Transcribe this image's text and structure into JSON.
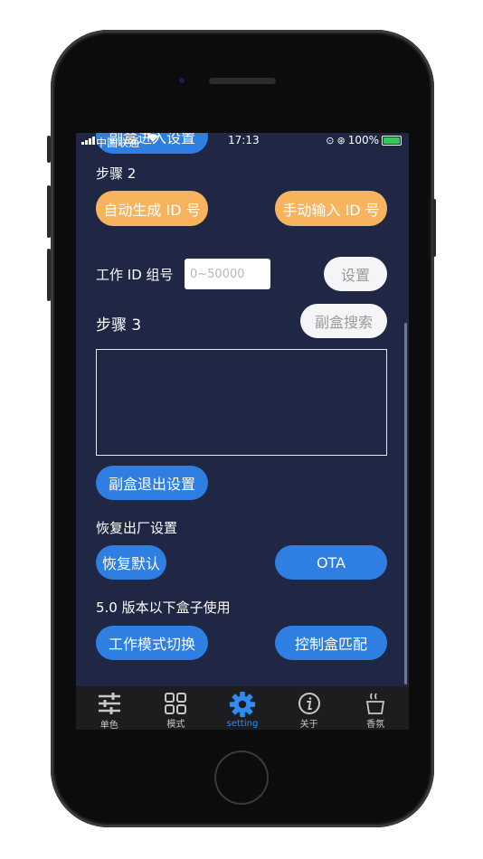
{
  "status": {
    "carrier": "中国联通",
    "time": "17:13",
    "battery": "100%"
  },
  "content": {
    "top_button": "副盒进入设置",
    "step2_label": "步骤 2",
    "auto_id_button": "自动生成 ID 号",
    "manual_id_button": "手动输入 ID 号",
    "work_id_label": "工作 ID 组号",
    "work_id_placeholder": "0~50000",
    "set_button": "设置",
    "step3_label": "步骤 3",
    "sub_search_button": "副盒搜索",
    "sub_exit_button": "副盒退出设置",
    "factory_label": "恢复出厂设置",
    "restore_button": "恢复默认",
    "ota_button": "OTA",
    "legacy_label": "5.0 版本以下盒子使用",
    "mode_switch_button": "工作模式切换",
    "control_match_button": "控制盒匹配"
  },
  "tabs": [
    {
      "label": "单色",
      "icon": "sliders-icon",
      "active": false
    },
    {
      "label": "模式",
      "icon": "grid-icon",
      "active": false
    },
    {
      "label": "setting",
      "icon": "gear-icon",
      "active": true
    },
    {
      "label": "关于",
      "icon": "info-icon",
      "active": false
    },
    {
      "label": "香氛",
      "icon": "aroma-cup-icon",
      "active": false
    }
  ],
  "colors": {
    "background": "#1f2745",
    "orange": "#f6b45f",
    "blue": "#2f7fe2",
    "tab_active": "#2f8bf0"
  }
}
